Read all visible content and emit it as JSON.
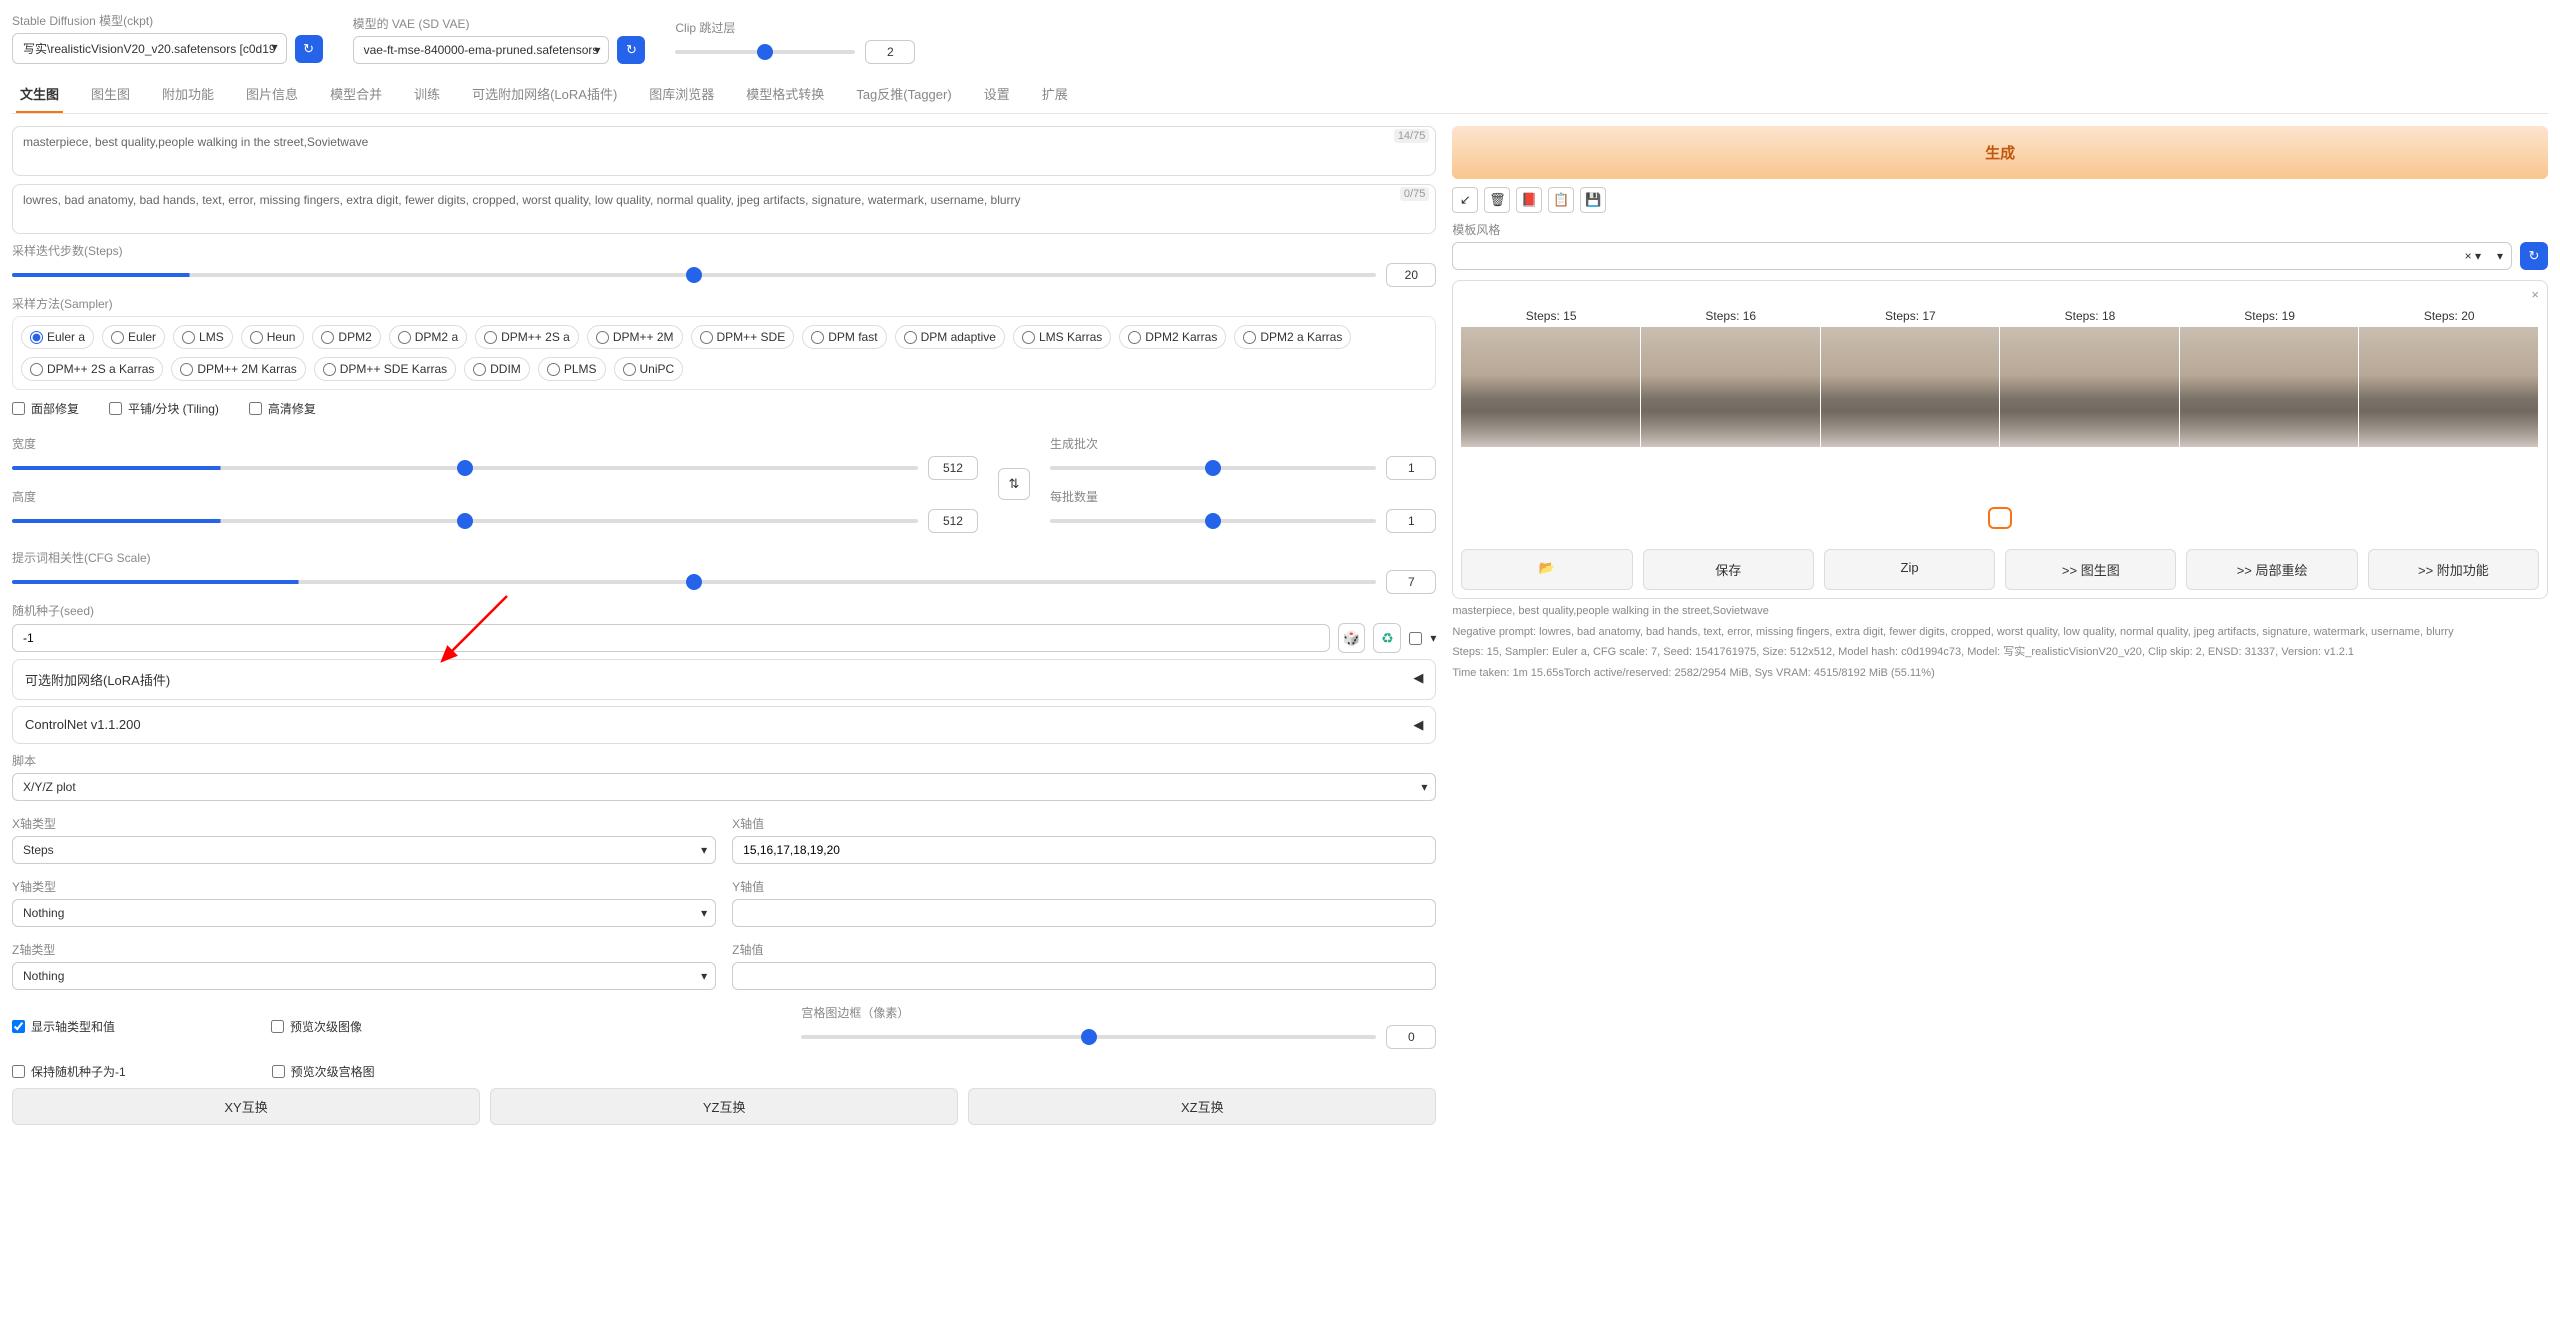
{
  "header": {
    "sd_label": "Stable Diffusion 模型(ckpt)",
    "sd_value": "写实\\realisticVisionV20_v20.safetensors [c0d19",
    "vae_label": "模型的 VAE (SD VAE)",
    "vae_value": "vae-ft-mse-840000-ema-pruned.safetensors",
    "clip_label": "Clip 跳过层",
    "clip_value": "2"
  },
  "tabs": [
    "文生图",
    "图生图",
    "附加功能",
    "图片信息",
    "模型合并",
    "训练",
    "可选附加网络(LoRA插件)",
    "图库浏览器",
    "模型格式转换",
    "Tag反推(Tagger)",
    "设置",
    "扩展"
  ],
  "prompt": {
    "pos": "masterpiece, best quality,people walking in the street,Sovietwave",
    "pos_count": "14/75",
    "neg": "lowres, bad anatomy, bad hands, text, error, missing fingers, extra digit, fewer digits, cropped, worst quality, low quality, normal quality, jpeg artifacts, signature, watermark, username, blurry",
    "neg_count": "0/75"
  },
  "steps": {
    "label": "采样迭代步数(Steps)",
    "value": "20"
  },
  "sampler": {
    "label": "采样方法(Sampler)",
    "items": [
      "Euler a",
      "Euler",
      "LMS",
      "Heun",
      "DPM2",
      "DPM2 a",
      "DPM++ 2S a",
      "DPM++ 2M",
      "DPM++ SDE",
      "DPM fast",
      "DPM adaptive",
      "LMS Karras",
      "DPM2 Karras",
      "DPM2 a Karras",
      "DPM++ 2S a Karras",
      "DPM++ 2M Karras",
      "DPM++ SDE Karras",
      "DDIM",
      "PLMS",
      "UniPC"
    ],
    "selected": 0
  },
  "checks": {
    "face": "面部修复",
    "tiling": "平铺/分块 (Tiling)",
    "hires": "高清修复"
  },
  "dims": {
    "width_l": "宽度",
    "width": "512",
    "height_l": "高度",
    "height": "512",
    "batch_count_l": "生成批次",
    "batch_count": "1",
    "batch_size_l": "每批数量",
    "batch_size": "1"
  },
  "cfg": {
    "label": "提示词相关性(CFG Scale)",
    "value": "7"
  },
  "seed": {
    "label": "随机种子(seed)",
    "value": "-1"
  },
  "collapse": {
    "lora": "可选附加网络(LoRA插件)",
    "cn": "ControlNet v1.1.200"
  },
  "script": {
    "label": "脚本",
    "value": "X/Y/Z plot",
    "x_type_l": "X轴类型",
    "x_type": "Steps",
    "x_val_l": "X轴值",
    "x_val": "15,16,17,18,19,20",
    "y_type_l": "Y轴类型",
    "y_type": "Nothing",
    "y_val_l": "Y轴值",
    "z_type_l": "Z轴类型",
    "z_type": "Nothing",
    "z_val_l": "Z轴值",
    "show_axis": "显示轴类型和值",
    "show_sub": "预览次级图像",
    "margin_l": "宫格图边框（像素）",
    "margin": "0",
    "keep_seed": "保持随机种子为-1",
    "show_sub2": "预览次级宫格图"
  },
  "swap_btns": {
    "xy": "XY互换",
    "yz": "YZ互换",
    "xz": "XZ互换"
  },
  "right": {
    "gen": "生成",
    "style_l": "模板风格",
    "steps_labels": [
      "Steps: 15",
      "Steps: 16",
      "Steps: 17",
      "Steps: 18",
      "Steps: 19",
      "Steps: 20"
    ],
    "actions": {
      "save": "保存",
      "zip": "Zip",
      "img2img": ">> 图生图",
      "inpaint": ">> 局部重绘",
      "extras": ">> 附加功能"
    },
    "info1": "masterpiece, best quality,people walking in the street,Sovietwave",
    "info2": "Negative prompt: lowres, bad anatomy, bad hands, text, error, missing fingers, extra digit, fewer digits, cropped, worst quality, low quality, normal quality, jpeg artifacts, signature, watermark, username, blurry",
    "info3": "Steps: 15, Sampler: Euler a, CFG scale: 7, Seed: 1541761975, Size: 512x512, Model hash: c0d1994c73, Model: 写实_realisticVisionV20_v20, Clip skip: 2, ENSD: 31337, Version: v1.2.1",
    "info4": "Time taken: 1m 15.65sTorch active/reserved: 2582/2954 MiB, Sys VRAM: 4515/8192 MiB (55.11%)"
  }
}
